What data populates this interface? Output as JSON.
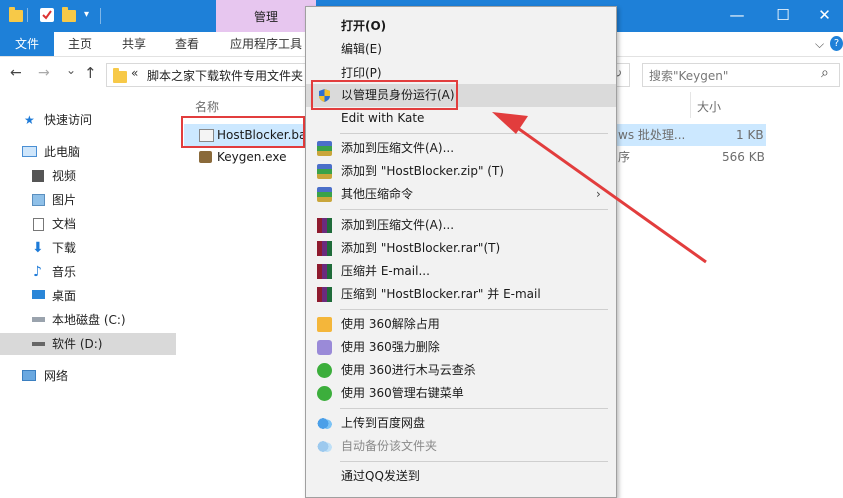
{
  "titlebar": {
    "manage_tab": "管理",
    "minimize": "—",
    "maximize": "☐",
    "close": "✕"
  },
  "ribbon": {
    "tabs": [
      "文件",
      "主页",
      "共享",
      "查看",
      "应用程序工具"
    ],
    "expand": "⌵",
    "help": "?"
  },
  "address": {
    "back": "←",
    "forward": "→",
    "dropdown": "⌄",
    "up": "↑",
    "path_prefix": "«",
    "path": "脚本之家下载软件专用文件夹",
    "refresh": "↻",
    "search_placeholder": "搜索\"Keygen\"",
    "search_icon": "⌕"
  },
  "nav": [
    {
      "label": "快速访问",
      "icon": "star-icon"
    },
    {
      "label": "此电脑",
      "icon": "computer-icon"
    },
    {
      "label": "视频",
      "icon": "video-icon"
    },
    {
      "label": "图片",
      "icon": "pictures-icon"
    },
    {
      "label": "文档",
      "icon": "documents-icon"
    },
    {
      "label": "下载",
      "icon": "download-icon"
    },
    {
      "label": "音乐",
      "icon": "music-icon"
    },
    {
      "label": "桌面",
      "icon": "desktop-icon"
    },
    {
      "label": "本地磁盘 (C:)",
      "icon": "drive-icon"
    },
    {
      "label": "软件 (D:)",
      "icon": "drive-icon"
    },
    {
      "label": "网络",
      "icon": "network-icon"
    }
  ],
  "filelist": {
    "headers": {
      "name": "名称",
      "size": "大小"
    },
    "rows": [
      {
        "name": "HostBlocker.ba",
        "type_tail": "ws 批处理...",
        "size": "1 KB"
      },
      {
        "name": "Keygen.exe",
        "type_tail": "序",
        "size": "566 KB"
      }
    ]
  },
  "menu": {
    "items": [
      {
        "label": "打开(O)",
        "bold": true
      },
      {
        "label": "编辑(E)"
      },
      {
        "label": "打印(P)"
      },
      {
        "label": "以管理员身份运行(A)",
        "icon": "uac-shield-icon"
      },
      {
        "label": "Edit with Kate"
      },
      {
        "label": "添加到压缩文件(A)...",
        "icon": "winrar-icon"
      },
      {
        "label": "添加到 \"HostBlocker.zip\" (T)",
        "icon": "winrar-icon"
      },
      {
        "label": "其他压缩命令",
        "icon": "winrar-icon",
        "arrow": "›"
      },
      {
        "label": "添加到压缩文件(A)...",
        "icon": "winrar-books-icon"
      },
      {
        "label": "添加到 \"HostBlocker.rar\"(T)",
        "icon": "winrar-books-icon"
      },
      {
        "label": "压缩并 E-mail...",
        "icon": "winrar-books-icon"
      },
      {
        "label": "压缩到 \"HostBlocker.rar\" 并 E-mail",
        "icon": "winrar-books-icon"
      },
      {
        "label": "使用 360解除占用",
        "icon": "unlock-360-icon"
      },
      {
        "label": "使用 360强力删除",
        "icon": "shred-360-icon"
      },
      {
        "label": "使用 360进行木马云查杀",
        "icon": "scan-360-icon"
      },
      {
        "label": "使用 360管理右键菜单",
        "icon": "menu-360-icon"
      },
      {
        "label": "上传到百度网盘",
        "icon": "baidu-cloud-icon"
      },
      {
        "label": "自动备份该文件夹",
        "icon": "baidu-cloud-icon",
        "disabled": true
      },
      {
        "label": "通过QQ发送到"
      }
    ]
  },
  "colors": {
    "accent": "#1e80d8",
    "manage": "#e7c6ef",
    "highlight": "#e23d3d"
  }
}
